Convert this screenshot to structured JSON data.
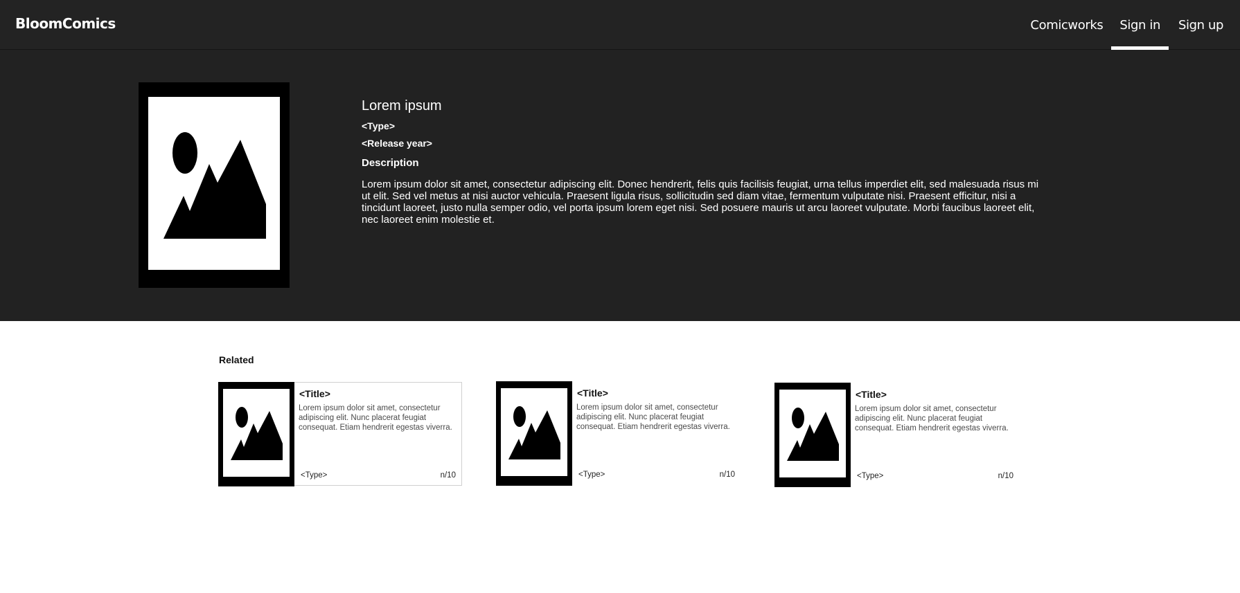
{
  "navbar": {
    "brand": "BloomComics",
    "links": [
      {
        "label": "Comicworks"
      },
      {
        "label": "Sign in"
      },
      {
        "label": "Sign up"
      }
    ]
  },
  "hero": {
    "cover_icon": "image-placeholder-icon",
    "title": "Lorem ipsum",
    "type": "<Type>",
    "release_year": "<Release year>",
    "description_heading": "Description",
    "description": "Lorem ipsum dolor sit amet, consectetur adipiscing elit. Donec hendrerit, felis quis facilisis feugiat, urna tellus imperdiet elit, sed malesuada risus mi ut elit. Sed vel metus at nisi auctor vehicula. Praesent ligula risus, sollicitudin sed diam vitae, fermentum vulputate nisi. Praesent efficitur, nisi a tincidunt laoreet, justo nulla semper odio, vel porta ipsum lorem eget nisi. Sed posuere mauris ut arcu laoreet vulputate. Morbi faucibus laoreet elit, nec laoreet enim molestie et."
  },
  "related": {
    "heading": "Related",
    "cards": [
      {
        "title": "<Title>",
        "description": "Lorem ipsum dolor sit amet, consectetur adipiscing elit. Nunc placerat feugiat consequat. Etiam hendrerit egestas viverra.",
        "type": "<Type>",
        "rating": "n/10"
      },
      {
        "title": "<Title>",
        "description": "Lorem ipsum dolor sit amet, consectetur adipiscing elit. Nunc placerat feugiat consequat. Etiam hendrerit egestas viverra.",
        "type": "<Type>",
        "rating": "n/10"
      },
      {
        "title": "<Title>",
        "description": "Lorem ipsum dolor sit amet, consectetur adipiscing elit. Nunc placerat feugiat consequat. Etiam hendrerit egestas viverra.",
        "type": "<Type>",
        "rating": "n/10"
      }
    ]
  }
}
